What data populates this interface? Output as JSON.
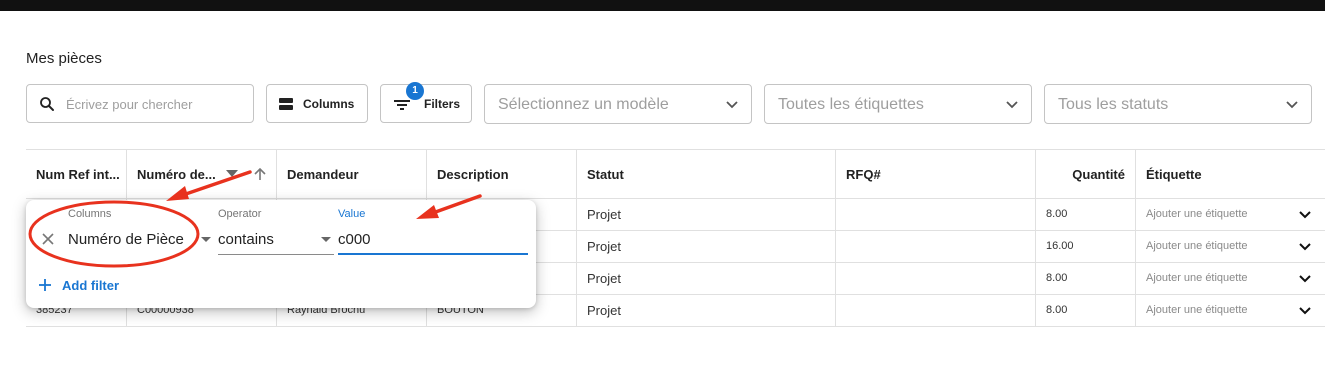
{
  "page": {
    "title": "Mes pièces"
  },
  "toolbar": {
    "search_placeholder": "Écrivez pour chercher",
    "columns_label": "Columns",
    "filters_label": "Filters",
    "filters_count": "1",
    "model_select": "Sélectionnez un modèle",
    "tags_select": "Toutes les étiquettes",
    "status_select": "Tous les statuts"
  },
  "grid": {
    "headers": [
      "Num Ref int...",
      "Numéro de...",
      "Demandeur",
      "Description",
      "Statut",
      "RFQ#",
      "Quantité",
      "Étiquette"
    ],
    "rows": [
      {
        "ref": "",
        "numero": "",
        "demandeur": "",
        "description": "",
        "statut": "Projet",
        "rfq": "",
        "quantite": "8.00",
        "etiquette": "Ajouter une étiquette"
      },
      {
        "ref": "",
        "numero": "",
        "demandeur": "",
        "description": "",
        "statut": "Projet",
        "rfq": "",
        "quantite": "16.00",
        "etiquette": "Ajouter une étiquette"
      },
      {
        "ref": "",
        "numero": "",
        "demandeur": "",
        "description": "",
        "statut": "Projet",
        "rfq": "",
        "quantite": "8.00",
        "etiquette": "Ajouter une étiquette"
      },
      {
        "ref": "385237",
        "numero": "C00000938",
        "demandeur": "Raynald Brochu",
        "description": "BOUTON",
        "statut": "Projet",
        "rfq": "",
        "quantite": "8.00",
        "etiquette": "Ajouter une étiquette"
      }
    ]
  },
  "filter_panel": {
    "columns_label": "Columns",
    "column_value": "Numéro de Pièce",
    "operator_label": "Operator",
    "operator_value": "contains",
    "value_label": "Value",
    "value_text": "c000",
    "add_filter_label": "Add filter"
  },
  "colors": {
    "accent": "#1976d2",
    "annotation": "#e8321e"
  }
}
